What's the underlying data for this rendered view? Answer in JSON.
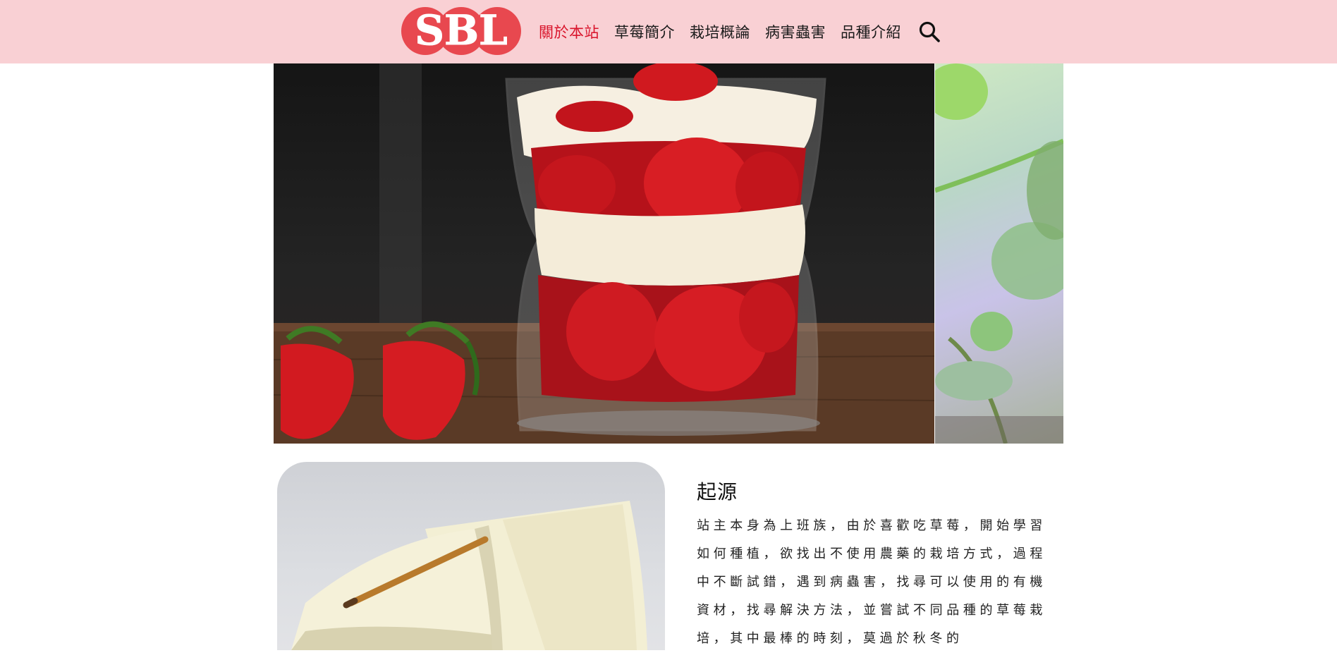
{
  "header": {
    "logo_text": "SBL",
    "nav": [
      {
        "label": "關於本站",
        "active": true
      },
      {
        "label": "草莓簡介",
        "active": false
      },
      {
        "label": "栽培概論",
        "active": false
      },
      {
        "label": "病害蟲害",
        "active": false
      },
      {
        "label": "品種介紹",
        "active": false
      }
    ],
    "search_icon": "search-icon"
  },
  "colors": {
    "header_bg": "#f9d0d4",
    "nav_active": "#d9142b",
    "logo_red": "#e8484f"
  },
  "content": {
    "section_title": "起源",
    "body": "站主本身為上班族，由於喜歡吃草莓，開始學習如何種植，欲找出不使用農藥的栽培方式，過程中不斷試錯，遇到病蟲害，找尋可以使用的有機資材，找尋解決方法，並嘗試不同品種的草莓栽培，其中最棒的時刻，莫過於秋冬的"
  }
}
